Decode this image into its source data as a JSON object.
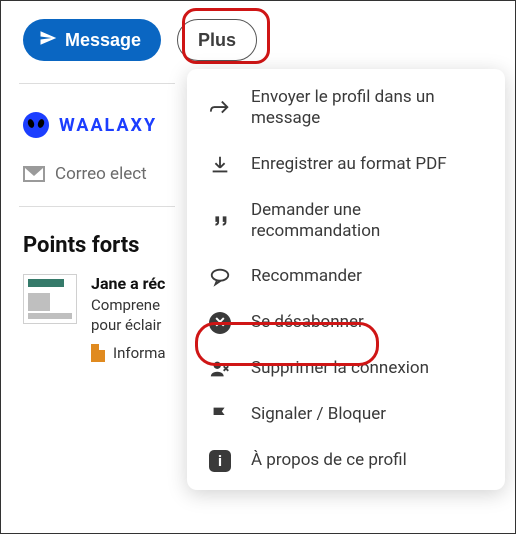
{
  "buttons": {
    "message": "Message",
    "plus": "Plus"
  },
  "company": {
    "name": "WAALAXY"
  },
  "email_label": "Correo elect",
  "section": {
    "title": "Points forts"
  },
  "card": {
    "title": "Jane a réc",
    "line1": "Comprene",
    "line2": "pour éclair",
    "info": "Informa"
  },
  "menu": {
    "items": [
      "Envoyer le profil dans un message",
      "Enregistrer au format PDF",
      "Demander une recommandation",
      "Recommander",
      "Se désabonner",
      "Supprimer la connexion",
      "Signaler / Bloquer",
      "À propos de ce profil"
    ]
  }
}
